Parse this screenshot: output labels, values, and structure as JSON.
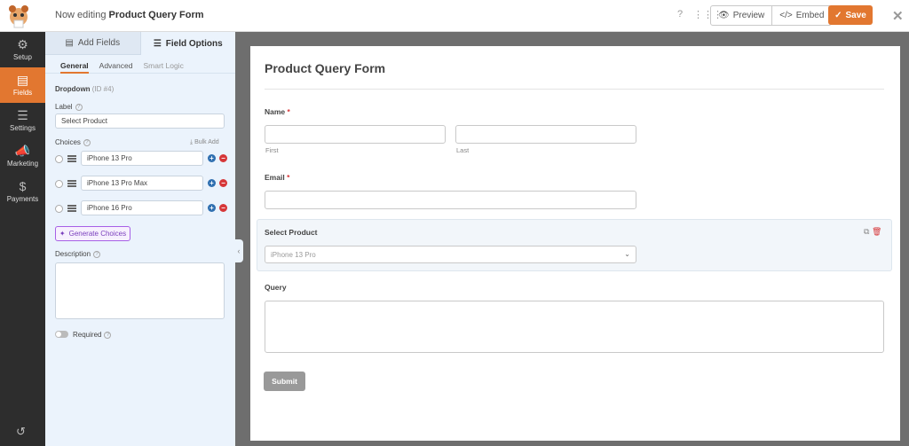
{
  "header": {
    "editing_prefix": "Now editing",
    "form_name": "Product Query Form",
    "preview_label": "Preview",
    "embed_label": "Embed",
    "save_label": "Save"
  },
  "sidebar": {
    "items": [
      {
        "label": "Setup",
        "icon": "gear-icon"
      },
      {
        "label": "Fields",
        "icon": "fields-icon"
      },
      {
        "label": "Settings",
        "icon": "sliders-icon"
      },
      {
        "label": "Marketing",
        "icon": "megaphone-icon"
      },
      {
        "label": "Payments",
        "icon": "dollar-icon"
      }
    ]
  },
  "panel": {
    "tabs": [
      "Add Fields",
      "Field Options"
    ],
    "subtabs": [
      "General",
      "Advanced",
      "Smart Logic"
    ],
    "field_type": "Dropdown",
    "field_id": "(ID #4)",
    "label_title": "Label",
    "label_value": "Select Product",
    "choices_title": "Choices",
    "bulk_add": "Bulk Add",
    "choices": [
      "iPhone 13 Pro",
      "iPhone 13 Pro Max",
      "iPhone 16 Pro"
    ],
    "generate_choices": "Generate Choices",
    "description_title": "Description",
    "required_label": "Required"
  },
  "form": {
    "title": "Product Query Form",
    "name_label": "Name",
    "first_sub": "First",
    "last_sub": "Last",
    "email_label": "Email",
    "select_label": "Select Product",
    "select_value": "iPhone 13 Pro",
    "query_label": "Query",
    "submit_label": "Submit"
  },
  "colors": {
    "accent": "#e27730",
    "sidebar_bg": "#2d2d2d",
    "panel_bg": "#ebf3fc"
  }
}
